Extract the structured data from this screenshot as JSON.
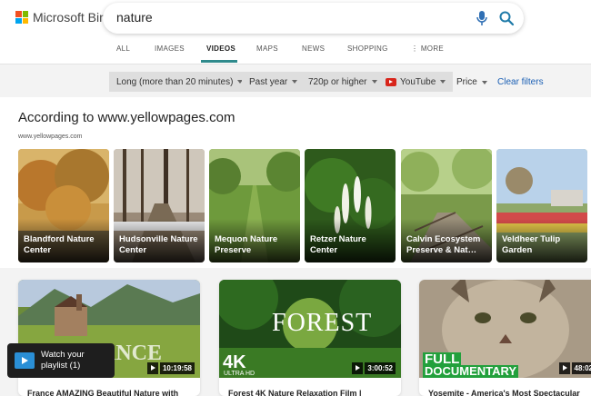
{
  "brand": {
    "name": "Microsoft Bing",
    "logo_colors": [
      "#f25022",
      "#7fba00",
      "#00a4ef",
      "#ffb900"
    ]
  },
  "search": {
    "query": "nature",
    "placeholder": ""
  },
  "tabs": [
    {
      "label": "ALL"
    },
    {
      "label": "IMAGES"
    },
    {
      "label": "VIDEOS",
      "active": true
    },
    {
      "label": "MAPS"
    },
    {
      "label": "NEWS"
    },
    {
      "label": "SHOPPING"
    },
    {
      "label": "MORE"
    }
  ],
  "accent_color": "#2f8a8c",
  "filters": {
    "length": "Long (more than 20 minutes)",
    "date": "Past year",
    "resolution": "720p or higher",
    "source": "YouTube",
    "price": "Price",
    "clear": "Clear filters"
  },
  "places": {
    "title": "According to www.yellowpages.com",
    "source": "www.yellowpages.com",
    "items": [
      {
        "name": "Blandford Nature Center"
      },
      {
        "name": "Hudsonville Nature Center"
      },
      {
        "name": "Mequon Nature Preserve"
      },
      {
        "name": "Retzer Nature Center"
      },
      {
        "name": "Calvin Ecosystem Preserve & Nat…"
      },
      {
        "name": "Veldheer Tulip Garden"
      }
    ]
  },
  "videos": [
    {
      "title": "France AMAZING Beautiful Nature with",
      "duration": "10:19:58",
      "thumb_text": "ANCE"
    },
    {
      "title": "Forest 4K Nature Relaxation Film |",
      "duration": "3:00:52",
      "thumb_text": "FOREST",
      "thumb_badge": "4K",
      "thumb_badge_sub": "ULTRA HD"
    },
    {
      "title": "Yosemite - America's Most Spectacular",
      "duration": "48:02",
      "thumb_text": "FULL",
      "thumb_text2": "DOCUMENTARY"
    }
  ],
  "playlist": {
    "label": "Watch your playlist (1)"
  }
}
